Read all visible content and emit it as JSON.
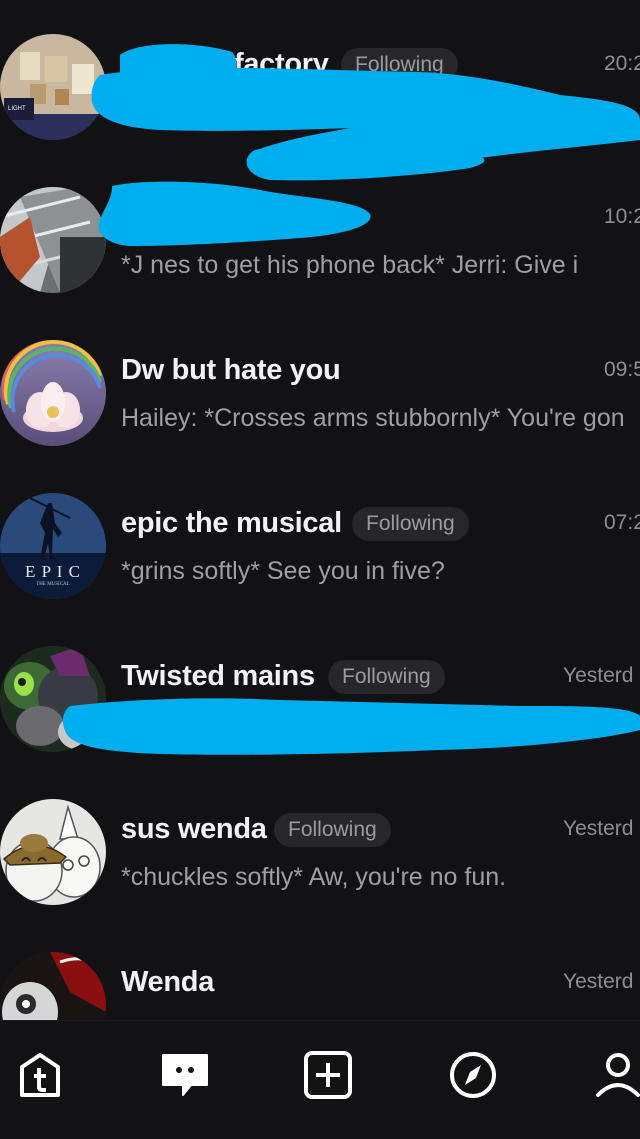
{
  "conversations": [
    {
      "name": "factory",
      "badge": "Following",
      "time": "20:2",
      "preview": ""
    },
    {
      "name": "",
      "badge": "",
      "time": "10:2",
      "preview": "*J          nes to get his phone back* Jerri: Give i"
    },
    {
      "name": "Dw but hate you",
      "badge": "",
      "time": "09:5",
      "preview": "Hailey: *Crosses arms stubbornly* You're gon"
    },
    {
      "name": "epic the musical",
      "badge": "Following",
      "time": "07:2",
      "preview": "*grins softly* See you in five?"
    },
    {
      "name": "Twisted mains",
      "badge": "Following",
      "time": "Yesterd",
      "preview": ""
    },
    {
      "name": "sus wenda",
      "badge": "Following",
      "time": "Yesterd",
      "preview": "*chuckles softly* Aw, you're no fun."
    },
    {
      "name": "Wenda",
      "badge": "",
      "time": "Yesterd",
      "preview": ""
    }
  ],
  "avatar_text": {
    "epic_logo": "E P I C",
    "epic_sub": "THE MUSICAL",
    "light_label": "LIGHT"
  },
  "tabs": [
    {
      "name": "home-tab",
      "icon": "tumblr-home-icon"
    },
    {
      "name": "messages-tab",
      "icon": "chat-bubble-icon",
      "active": true
    },
    {
      "name": "create-tab",
      "icon": "plus-square-icon"
    },
    {
      "name": "explore-tab",
      "icon": "compass-icon"
    },
    {
      "name": "profile-tab",
      "icon": "person-icon"
    }
  ],
  "colors": {
    "background": "#121214",
    "redaction": "#00aeef",
    "badge_bg": "#26262b",
    "muted_text": "#9e9ea4"
  }
}
